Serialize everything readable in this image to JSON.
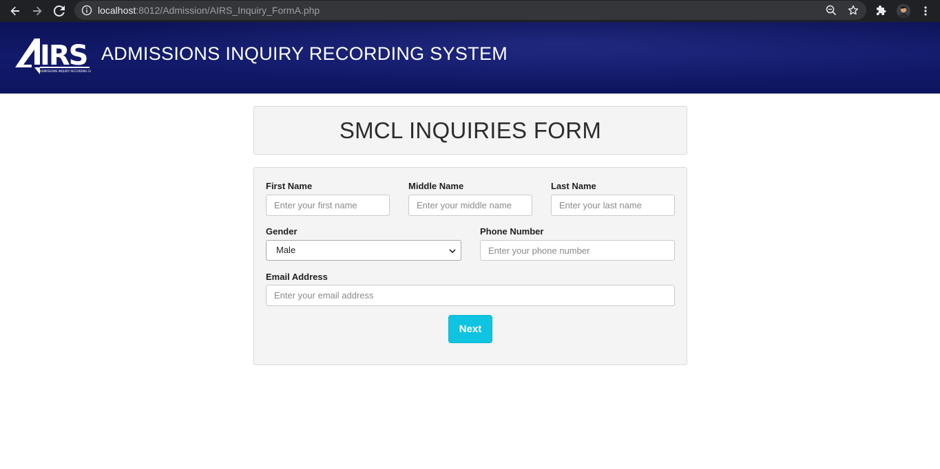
{
  "browser": {
    "url_host": "localhost",
    "url_path": ":8012/Admission/AIRS_Inquiry_FormA.php"
  },
  "header": {
    "logo_text": "AIRS",
    "logo_subtext": "ADMISSIONS INQUIRY RECORDING SYSTEM",
    "title": "ADMISSIONS INQUIRY RECORDING SYSTEM"
  },
  "form": {
    "title": "SMCL INQUIRIES FORM",
    "first_name": {
      "label": "First Name",
      "placeholder": "Enter your first name",
      "value": ""
    },
    "middle_name": {
      "label": "Middle Name",
      "placeholder": "Enter your middle name",
      "value": ""
    },
    "last_name": {
      "label": "Last Name",
      "placeholder": "Enter your last name",
      "value": ""
    },
    "gender": {
      "label": "Gender",
      "selected": "Male"
    },
    "phone": {
      "label": "Phone Number",
      "placeholder": "Enter your phone number",
      "value": ""
    },
    "email": {
      "label": "Email Address",
      "placeholder": "Enter your email address",
      "value": ""
    },
    "next_label": "Next"
  },
  "colors": {
    "header_bg": "#0c1257",
    "panel_bg": "#f4f4f4",
    "accent": "#0fc4e0"
  }
}
